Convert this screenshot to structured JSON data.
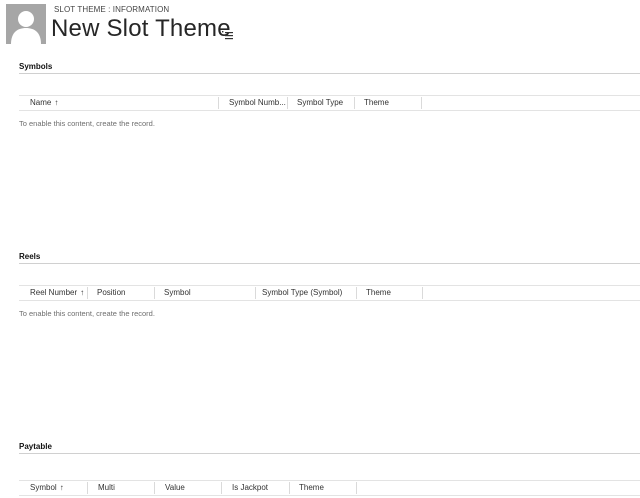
{
  "header": {
    "breadcrumb": "SLOT THEME : INFORMATION",
    "title": "New Slot Theme",
    "avatar_icon": "user-silhouette-icon",
    "menu_icon": "dropdown-menu-icon"
  },
  "sections": {
    "symbols": {
      "title": "Symbols",
      "columns": [
        "Name",
        "Symbol Numb...",
        "Symbol Type",
        "Theme"
      ],
      "empty_message": "To enable this content, create the record."
    },
    "reels": {
      "title": "Reels",
      "columns": [
        "Reel Number",
        "Position",
        "Symbol",
        "Symbol Type (Symbol)",
        "Theme"
      ],
      "empty_message": "To enable this content, create the record."
    },
    "paytable": {
      "title": "Paytable",
      "columns": [
        "Symbol",
        "Multi",
        "Value",
        "Is Jackpot",
        "Theme"
      ]
    }
  },
  "colors": {
    "avatar_bg": "#a6a6a6",
    "rule": "#d0d0d0",
    "muted_text": "#6e6e6e"
  }
}
